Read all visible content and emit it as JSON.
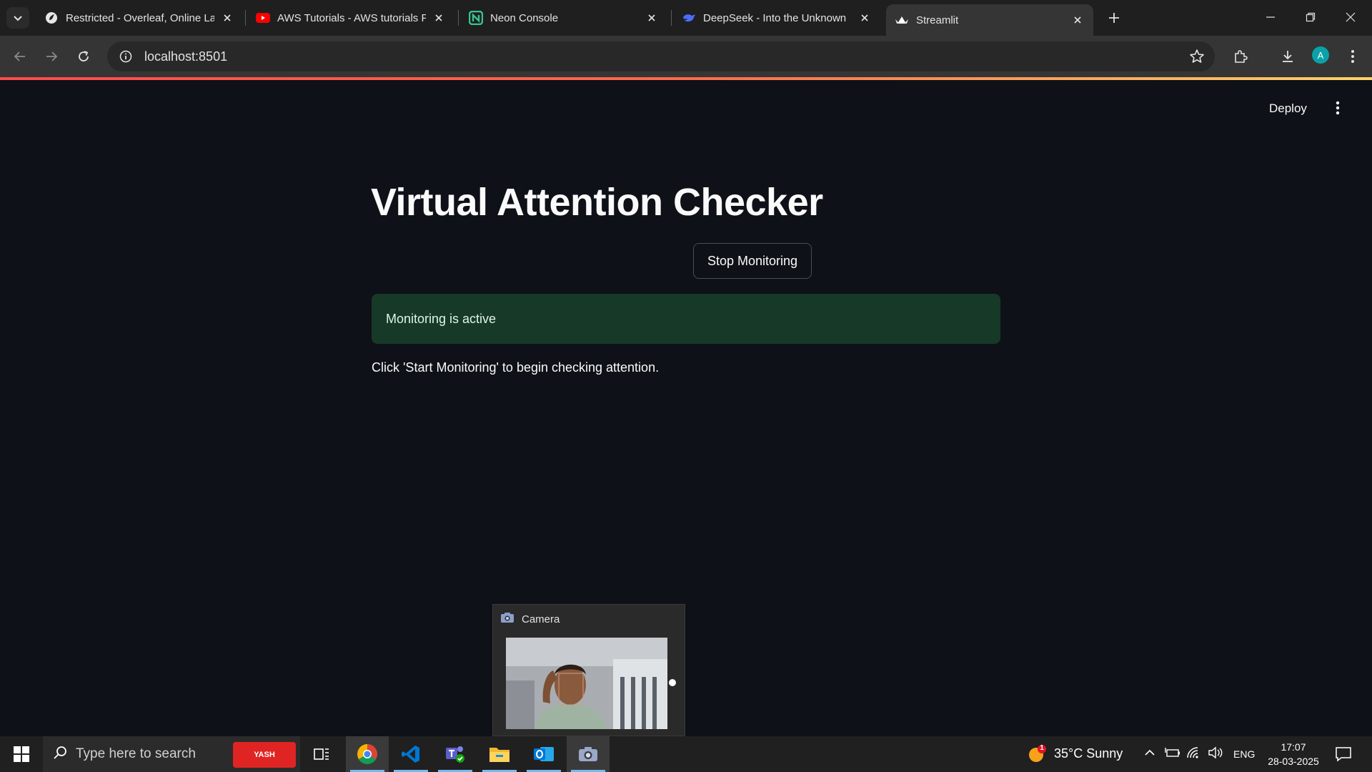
{
  "browser": {
    "tabs": [
      {
        "title": "Restricted - Overleaf, Online LaTeX Editor",
        "icon": "overleaf-icon",
        "active": false
      },
      {
        "title": "AWS Tutorials - AWS tutorials For Beginners",
        "icon": "youtube-icon",
        "active": false
      },
      {
        "title": "Neon Console",
        "icon": "neon-icon",
        "active": false
      },
      {
        "title": "DeepSeek - Into the Unknown",
        "icon": "deepseek-icon",
        "active": false
      },
      {
        "title": "Streamlit",
        "icon": "streamlit-icon",
        "active": true
      }
    ],
    "url": "localhost:8501",
    "profile_initial": "A"
  },
  "app": {
    "deploy_label": "Deploy",
    "title": "Virtual Attention Checker",
    "button_label": "Stop Monitoring",
    "status_message": "Monitoring is active",
    "help_text": "Click 'Start Monitoring' to begin checking attention."
  },
  "camera": {
    "title": "Camera"
  },
  "taskbar": {
    "search_placeholder": "Type here to search",
    "search_badge": "YASH",
    "weather": "35°C  Sunny",
    "weather_badge": "1",
    "language": "ENG",
    "time": "17:07",
    "date": "28-03-2025"
  },
  "colors": {
    "page_bg": "#0e1117",
    "success_bg": "#173928",
    "accent_bar_start": "#ff4b4b",
    "accent_bar_end": "#fdd36a"
  }
}
